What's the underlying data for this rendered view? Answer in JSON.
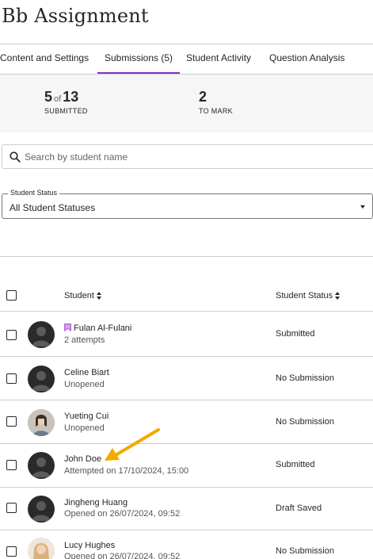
{
  "page": {
    "title": "Bb Assignment"
  },
  "tabs": [
    {
      "label": "Content and Settings",
      "active": false
    },
    {
      "label": "Submissions (5)",
      "active": true
    },
    {
      "label": "Student Activity",
      "active": false
    },
    {
      "label": "Question Analysis",
      "active": false
    }
  ],
  "summary": {
    "submitted_count": "5",
    "of_label": "of",
    "total_count": "13",
    "submitted_label": "SUBMITTED",
    "to_mark_count": "2",
    "to_mark_label": "TO MARK"
  },
  "search": {
    "placeholder": "Search by student name",
    "value": ""
  },
  "status_filter": {
    "legend": "Student Status",
    "selected": "All Student Statuses"
  },
  "table": {
    "headers": {
      "student": "Student",
      "status": "Student Status"
    },
    "rows": [
      {
        "name": "Fulan Al-Fulani",
        "sub": "2 attempts",
        "status": "Submitted",
        "flagged": true,
        "avatar": "placeholder"
      },
      {
        "name": "Celine Biart",
        "sub": "Unopened",
        "status": "No Submission",
        "flagged": false,
        "avatar": "placeholder"
      },
      {
        "name": "Yueting Cui",
        "sub": "Unopened",
        "status": "No Submission",
        "flagged": false,
        "avatar": "photo"
      },
      {
        "name": "John Doe",
        "sub": "Attempted on 17/10/2024, 15:00",
        "status": "Submitted",
        "flagged": false,
        "avatar": "placeholder"
      },
      {
        "name": "Jingheng Huang",
        "sub": "Opened on 26/07/2024, 09:52",
        "status": "Draft Saved",
        "flagged": false,
        "avatar": "placeholder"
      },
      {
        "name": "Lucy Hughes",
        "sub": "Opened on 26/07/2024, 09:52",
        "status": "No Submission",
        "flagged": false,
        "avatar": "photo"
      }
    ]
  },
  "colors": {
    "accent": "#8b33b9",
    "annotation_arrow": "#f2a900"
  },
  "icons": {
    "search": "search-icon",
    "sort": "sort-icon",
    "flag": "flag-icon",
    "dropdown": "chevron-down-icon",
    "annotation": "arrow-annotation"
  }
}
